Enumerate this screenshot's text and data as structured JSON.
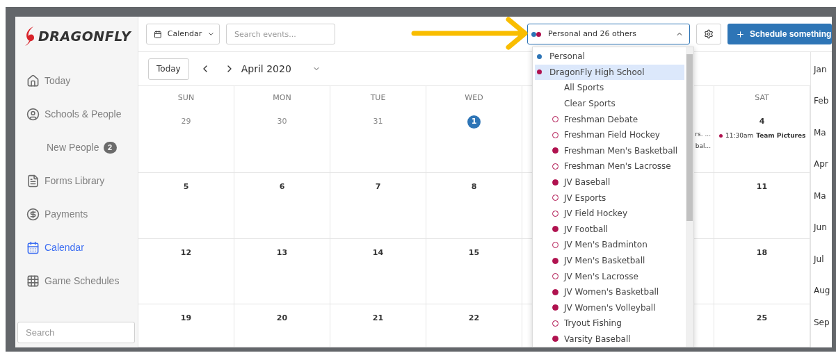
{
  "logo": {
    "text": "DRAGONFLY"
  },
  "sidebar": {
    "items": [
      {
        "label": "Today",
        "selected": false
      },
      {
        "label": "Schools & People",
        "selected": false,
        "children": [
          {
            "label": "New People",
            "badge": "2",
            "selected": false
          }
        ]
      },
      {
        "label": "Forms Library",
        "selected": false
      },
      {
        "label": "Payments",
        "selected": false
      },
      {
        "label": "Calendar",
        "selected": true
      },
      {
        "label": "Game Schedules",
        "selected": false
      }
    ],
    "search": {
      "placeholder": "Search"
    }
  },
  "toolbar": {
    "view_select": {
      "value": "Calendar"
    },
    "search": {
      "placeholder": "Search events..."
    },
    "calendars_select": {
      "value": "Personal and 26 others",
      "expanded": true
    },
    "schedule_button": "Schedule something"
  },
  "nav": {
    "today_button": "Today",
    "month": "April 2020"
  },
  "calendar": {
    "days": {
      "sun": "SUN",
      "mon": "MON",
      "tue": "TUE",
      "wed": "WED",
      "sat": "SAT"
    },
    "weeks": [
      {
        "sun": {
          "day": "29",
          "muted": true
        },
        "mon": {
          "day": "30",
          "muted": true
        },
        "tue": {
          "day": "31",
          "muted": true
        },
        "wed": {
          "day": "1",
          "today": true
        },
        "fri": {
          "events": [
            {
              "text": "rs. ..."
            },
            {
              "text": "bal..."
            }
          ]
        },
        "sat": {
          "day": "4",
          "events": [
            {
              "time": "11:30am",
              "title": "Team Pictures",
              "color": "#b0124f"
            }
          ]
        }
      },
      {
        "sun": {
          "day": "5"
        },
        "mon": {
          "day": "6"
        },
        "tue": {
          "day": "7"
        },
        "wed": {
          "day": "8"
        },
        "sat": {
          "day": "11"
        }
      },
      {
        "sun": {
          "day": "12"
        },
        "mon": {
          "day": "13"
        },
        "tue": {
          "day": "14"
        },
        "wed": {
          "day": "15"
        },
        "sat": {
          "day": "18"
        }
      },
      {
        "sun": {
          "day": "19"
        },
        "mon": {
          "day": "20"
        },
        "tue": {
          "day": "21"
        },
        "wed": {
          "day": "22"
        },
        "sat": {
          "day": "25"
        }
      }
    ],
    "months": [
      "Jan",
      "Feb",
      "Ma",
      "Apr",
      "Ma",
      "Jun",
      "Jul",
      "Aug",
      "Sep"
    ]
  },
  "dropdown": {
    "items": [
      {
        "kind": "calendar",
        "label": "Personal",
        "color": "#2e75b6",
        "selected": false
      },
      {
        "kind": "calendar",
        "label": "DragonFly High School",
        "color": "#b0124f",
        "selected": true
      },
      {
        "kind": "action",
        "label": "All Sports",
        "selected": false
      },
      {
        "kind": "action",
        "label": "Clear Sports",
        "selected": false
      },
      {
        "kind": "sport",
        "label": "Freshman Debate",
        "checked": false,
        "selected": false
      },
      {
        "kind": "sport",
        "label": "Freshman Field Hockey",
        "checked": false,
        "selected": false
      },
      {
        "kind": "sport",
        "label": "Freshman Men's Basketball",
        "checked": true,
        "selected": false
      },
      {
        "kind": "sport",
        "label": "Freshman Men's Lacrosse",
        "checked": false,
        "selected": false
      },
      {
        "kind": "sport",
        "label": "JV Baseball",
        "checked": true,
        "selected": false
      },
      {
        "kind": "sport",
        "label": "JV Esports",
        "checked": false,
        "selected": false
      },
      {
        "kind": "sport",
        "label": "JV Field Hockey",
        "checked": false,
        "selected": false
      },
      {
        "kind": "sport",
        "label": "JV Football",
        "checked": true,
        "selected": false
      },
      {
        "kind": "sport",
        "label": "JV Men's Badminton",
        "checked": false,
        "selected": false
      },
      {
        "kind": "sport",
        "label": "JV Men's Basketball",
        "checked": true,
        "selected": false
      },
      {
        "kind": "sport",
        "label": "JV Men's Lacrosse",
        "checked": false,
        "selected": false
      },
      {
        "kind": "sport",
        "label": "JV Women's Basketball",
        "checked": true,
        "selected": false
      },
      {
        "kind": "sport",
        "label": "JV Women's Volleyball",
        "checked": true,
        "selected": false
      },
      {
        "kind": "sport",
        "label": "Tryout Fishing",
        "checked": false,
        "selected": false
      },
      {
        "kind": "sport",
        "label": "Varsity Baseball",
        "checked": true,
        "selected": false
      }
    ]
  }
}
